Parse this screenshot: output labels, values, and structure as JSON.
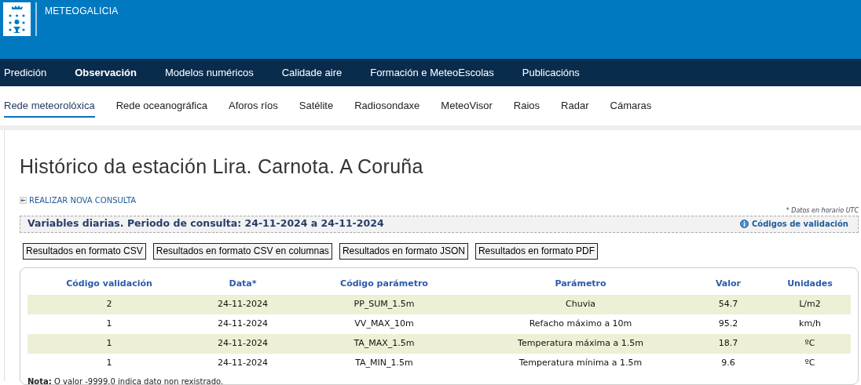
{
  "header": {
    "brand": "METEOGALICIA"
  },
  "main_nav": [
    {
      "label": "Predición",
      "selected": false
    },
    {
      "label": "Observación",
      "selected": true
    },
    {
      "label": "Modelos numéricos",
      "selected": false
    },
    {
      "label": "Calidade aire",
      "selected": false
    },
    {
      "label": "Formación e MeteoEscolas",
      "selected": false
    },
    {
      "label": "Publicacións",
      "selected": false
    }
  ],
  "sub_nav": [
    {
      "label": "Rede meteorolóxica",
      "selected": true
    },
    {
      "label": "Rede oceanográfica",
      "selected": false
    },
    {
      "label": "Aforos ríos",
      "selected": false
    },
    {
      "label": "Satélite",
      "selected": false
    },
    {
      "label": "Radiosondaxe",
      "selected": false
    },
    {
      "label": "MeteoVisor",
      "selected": false
    },
    {
      "label": "Raios",
      "selected": false
    },
    {
      "label": "Radar",
      "selected": false
    },
    {
      "label": "Cámaras",
      "selected": false
    }
  ],
  "title": "Histórico da estación Lira. Carnota. A Coruña",
  "new_query_link": "REALIZAR NOVA CONSULTA",
  "utc_note": "* Datos en horario UTC",
  "period_heading": "Variables diarias. Periodo de consulta: 24-11-2024 a 24-11-2024",
  "validation_codes_link": "Códigos de validación",
  "export_buttons": [
    "Resultados en formato CSV",
    "Resultados en formato CSV en columnas",
    "Resultados en formato JSON",
    "Resultados en formato PDF"
  ],
  "table": {
    "columns": [
      "Código validación",
      "Data*",
      "Código parámetro",
      "Parámetro",
      "Valor",
      "Unidades"
    ],
    "rows": [
      [
        "2",
        "24-11-2024",
        "PP_SUM_1.5m",
        "Chuvia",
        "54.7",
        "L/m2"
      ],
      [
        "1",
        "24-11-2024",
        "VV_MAX_10m",
        "Refacho máximo a 10m",
        "95.2",
        "km/h"
      ],
      [
        "1",
        "24-11-2024",
        "TA_MAX_1.5m",
        "Temperatura máxima a 1.5m",
        "18.7",
        "ºC"
      ],
      [
        "1",
        "24-11-2024",
        "TA_MIN_1.5m",
        "Temperatura mínima a 1.5m",
        "9.6",
        "ºC"
      ]
    ]
  },
  "note": "**Nota:** O valor -9999.0 indica dato non rexistrado."
}
